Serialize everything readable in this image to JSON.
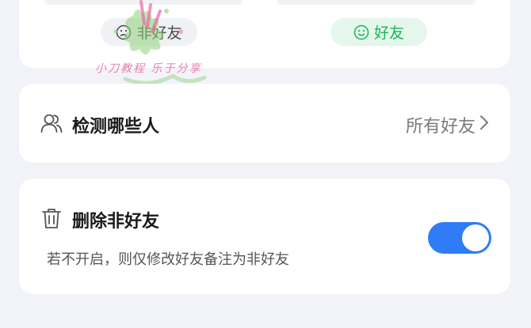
{
  "filter_pills": {
    "not_friend_label": "非好友",
    "friend_label": "好友"
  },
  "watermark": {
    "text": "小刀教程 乐于分享"
  },
  "detect_who": {
    "title": "检测哪些人",
    "value": "所有好友"
  },
  "delete_non_friends": {
    "title": "删除非好友",
    "description": "若不开启，则仅修改好友备注为非好友",
    "toggle_on": true
  },
  "colors": {
    "accent_blue": "#2f7cf6",
    "friend_green": "#14b653",
    "background": "#f2f3f8"
  }
}
